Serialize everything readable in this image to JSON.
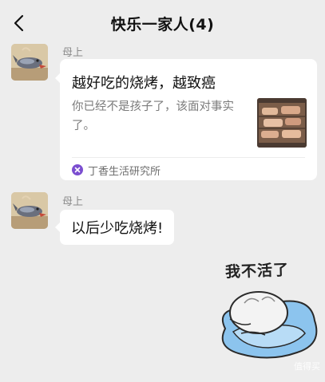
{
  "header": {
    "title": "快乐一家人(4)"
  },
  "messages": [
    {
      "sender": "母上",
      "type": "link-card",
      "title": "越好吃的烧烤，越致癌",
      "description": "你已经不是孩子了，该面对事实了。",
      "source": "丁香生活研究所"
    },
    {
      "sender": "母上",
      "type": "text",
      "text": "以后少吃烧烤!"
    },
    {
      "type": "sticker",
      "caption": "我不活了"
    }
  ],
  "watermark": "值得买",
  "colors": {
    "background": "#ededed",
    "bubble": "#ffffff",
    "source_icon": "#7b4ed0",
    "sticker_cushion": "#8cc4ee"
  }
}
